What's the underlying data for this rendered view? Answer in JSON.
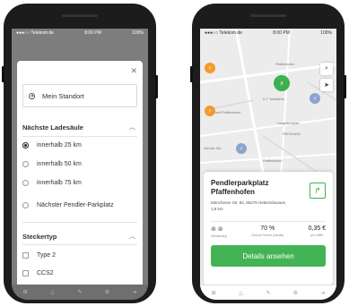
{
  "status": {
    "carrier": "●●●○○ Telekom.de",
    "time": "8:00 PM",
    "battery": "100%"
  },
  "filter": {
    "location_option": "Mein Standort",
    "nearest_station": {
      "title": "Nächste Ladesäule",
      "options": [
        "innerhalb 25 km",
        "innerhalb 50 km",
        "innerhalb 75 km",
        "Nächster Pendler-Parkplatz"
      ],
      "selected": 0
    },
    "plug_type": {
      "title": "Steckertyp",
      "options": [
        "Type 2",
        "CCS2"
      ]
    }
  },
  "map": {
    "labels": [
      "Pfaffenhofen",
      "A.T Tankstelle",
      "Dank Pfaffenhofen",
      "Umgebungsstr.",
      "REISGANG",
      "Schuler Mü..",
      "Pfaffenhofen"
    ]
  },
  "card": {
    "title": "Pendlerparkplatz Pfaffenhofen",
    "address": "Münchener Str. 84, 85276 Hettenshausen",
    "distance": "1,8 km",
    "plug_label": "Steckertyp",
    "power_value": "70 %",
    "power_label": "Grüner Strom (heute)",
    "price_value": "0,35 €",
    "price_label": "pro kWh",
    "details_label": "Details ansehen"
  },
  "colors": {
    "accent": "#43b455",
    "pin_orange": "#f39a2c",
    "pin_blue": "#8aa4cf"
  }
}
